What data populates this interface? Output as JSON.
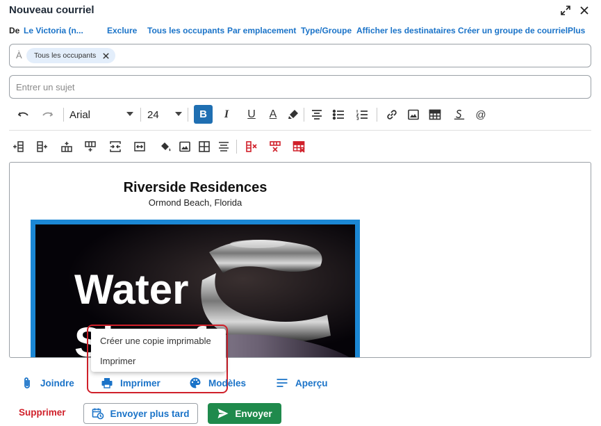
{
  "window": {
    "title": "Nouveau courriel"
  },
  "from_row": {
    "label": "De",
    "sender": "Le Victoria (n...",
    "links": [
      "Exclure",
      "Tous les occupants",
      "Par emplacement",
      "Type/Groupe",
      "Afficher les destinataires",
      "Créer un groupe de courriel",
      "Plus"
    ]
  },
  "to": {
    "label": "À",
    "chips": [
      "Tous les occupants"
    ]
  },
  "subject": {
    "value": "",
    "placeholder": "Entrer un sujet"
  },
  "toolbar": {
    "font": "Arial",
    "size": "24",
    "bold_label": "B",
    "italic_label": "I",
    "underline_label": "U",
    "font_color_label": "A",
    "mention_label": "@"
  },
  "editor": {
    "heading": "Riverside Residences",
    "subheading": "Ormond Beach, Florida",
    "banner_text": "Water\nSh  rt f"
  },
  "print_menu": {
    "items": [
      "Créer une copie imprimable",
      "Imprimer"
    ]
  },
  "actions": {
    "attach": "Joindre",
    "print": "Imprimer",
    "templates": "Modèles",
    "preview": "Aperçu"
  },
  "footer": {
    "delete": "Supprimer",
    "send_later": "Envoyer plus tard",
    "send": "Envoyer"
  },
  "colors": {
    "accent": "#1a73c8",
    "danger": "#d0202a",
    "send": "#1f8a4c",
    "bold_active": "#1f6fb2",
    "banner_border": "#1b87d4"
  }
}
